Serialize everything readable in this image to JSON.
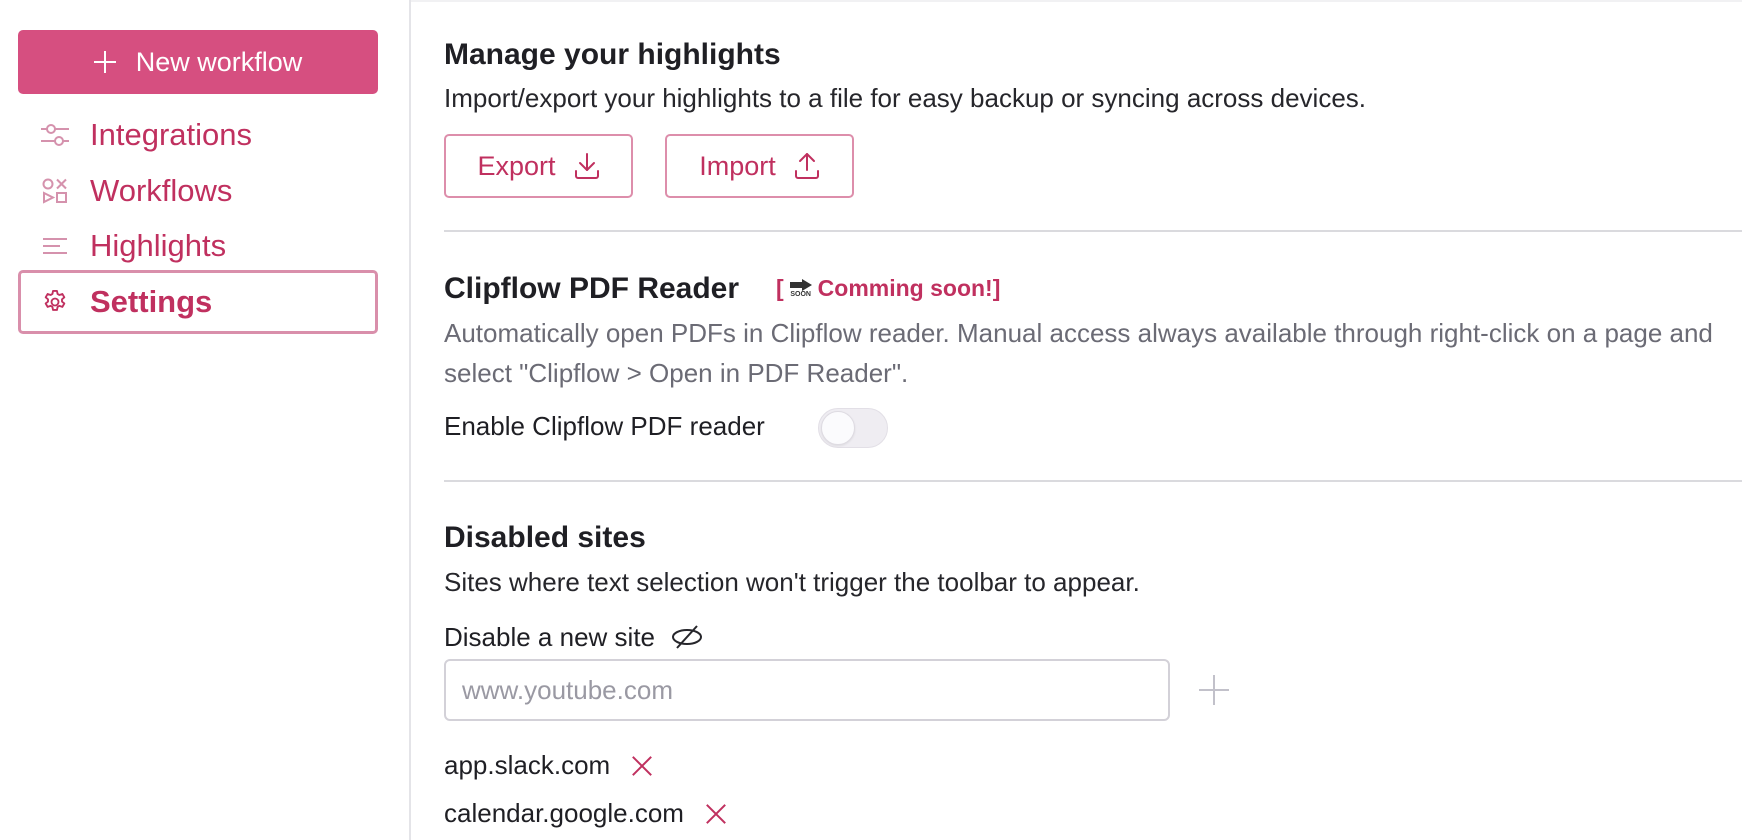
{
  "colors": {
    "accent": "#c0305f",
    "primary_button": "#d64f80",
    "border_accent": "#dd8eab"
  },
  "sidebar": {
    "new_button": {
      "label": "New workflow",
      "icon": "plus-icon"
    },
    "items": [
      {
        "label": "Integrations",
        "icon": "sliders-icon",
        "active": false
      },
      {
        "label": "Workflows",
        "icon": "shapes-icon",
        "active": false
      },
      {
        "label": "Highlights",
        "icon": "lines-icon",
        "active": false
      },
      {
        "label": "Settings",
        "icon": "gear-icon",
        "active": true
      }
    ]
  },
  "highlights_section": {
    "title": "Manage your highlights",
    "description": "Import/export your highlights to a file for easy backup or syncing across devices.",
    "export_label": "Export",
    "import_label": "Import"
  },
  "pdf_section": {
    "title": "Clipflow PDF Reader",
    "badge_open": "[",
    "badge_icon_text": "SOON",
    "badge_text": "Comming soon!]",
    "description": "Automatically open PDFs in Clipflow reader. Manual access always available through right-click on a page and select \"Clipflow > Open in PDF Reader\".",
    "toggle_label": "Enable Clipflow PDF reader",
    "toggle_enabled": false
  },
  "disabled_sites": {
    "title": "Disabled sites",
    "description": "Sites where text selection won't trigger the toolbar to appear.",
    "field_label": "Disable a new site",
    "input_value": "",
    "input_placeholder": "www.youtube.com",
    "sites": [
      "app.slack.com",
      "calendar.google.com"
    ]
  }
}
